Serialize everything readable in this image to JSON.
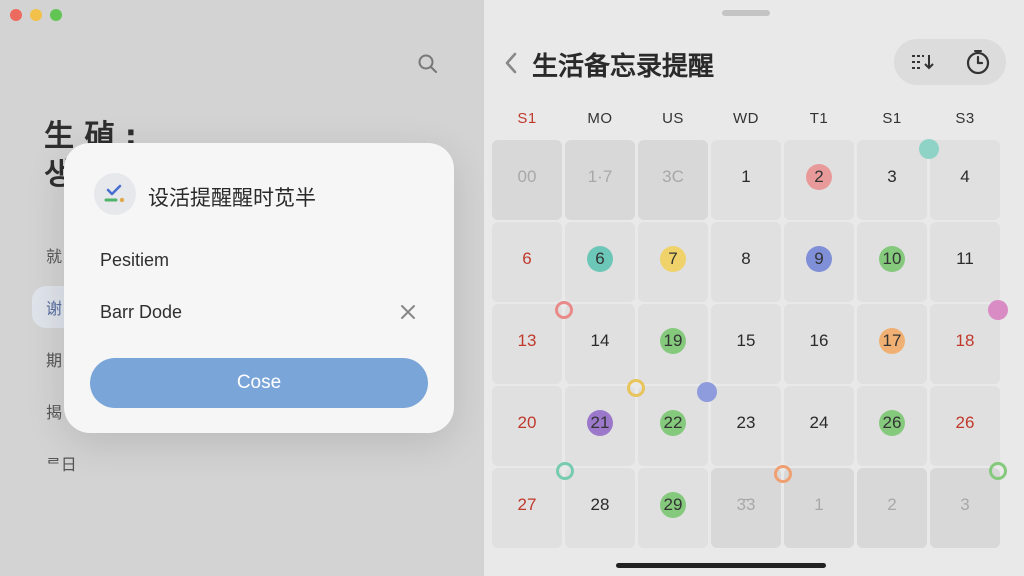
{
  "window": {
    "controls": [
      "close",
      "minimize",
      "zoom"
    ]
  },
  "left_pane": {
    "title_line1": "生 碵 :",
    "title_line2": "생",
    "items": [
      {
        "label": "就",
        "active": false
      },
      {
        "label": "谢",
        "active": true
      },
      {
        "label": "期",
        "active": false
      },
      {
        "label": "揭",
        "active": false
      },
      {
        "label": "ᄅ日",
        "active": false
      }
    ],
    "search_icon": "search-icon"
  },
  "modal": {
    "icon": "checklist-icon",
    "title": "设活提醒醒时苋半",
    "row1": "Pesitiem",
    "row2": "Barr Dode",
    "clear_icon": "close-icon",
    "button_label": "Cose"
  },
  "calendar": {
    "title": "生活备忘录提醒",
    "actions": [
      "export-icon",
      "clock-icon"
    ],
    "weekdays": [
      "S1",
      "MO",
      "US",
      "WD",
      "T1",
      "S1",
      "S3"
    ],
    "weeks": [
      [
        {
          "d": "00",
          "out": true
        },
        {
          "d": "1·7",
          "out": true
        },
        {
          "d": "3C",
          "out": true
        },
        {
          "d": "1"
        },
        {
          "d": "2",
          "c": "#e89a9a"
        },
        {
          "d": "3"
        },
        {
          "d": "4"
        }
      ],
      [
        {
          "d": "6",
          "sun": true
        },
        {
          "d": "6",
          "c": "#6cc7b8"
        },
        {
          "d": "7",
          "c": "#efd36a"
        },
        {
          "d": "8"
        },
        {
          "d": "9",
          "c": "#7f8fd8"
        },
        {
          "d": "10",
          "c": "#85c97d"
        },
        {
          "d": "11"
        }
      ],
      [
        {
          "d": "13",
          "sun": true
        },
        {
          "d": "14"
        },
        {
          "d": "19",
          "c": "#85c97d"
        },
        {
          "d": "15"
        },
        {
          "d": "16"
        },
        {
          "d": "17",
          "c": "#f1b073"
        },
        {
          "d": "18",
          "sun": true
        }
      ],
      [
        {
          "d": "20",
          "sun": true
        },
        {
          "d": "21",
          "c": "#9b78c9"
        },
        {
          "d": "22",
          "c": "#85c97d"
        },
        {
          "d": "23"
        },
        {
          "d": "24"
        },
        {
          "d": "26",
          "c": "#85c97d"
        },
        {
          "d": "26",
          "sun": true
        }
      ],
      [
        {
          "d": "27",
          "sun": true
        },
        {
          "d": "28"
        },
        {
          "d": "29",
          "c": "#85c97d"
        },
        {
          "d": "3̄3",
          "out": true
        },
        {
          "d": "1",
          "out": true
        },
        {
          "d": "2",
          "out": true
        },
        {
          "d": "3",
          "out": true
        }
      ]
    ],
    "colors": {
      "accent": "#7aa5d9",
      "sunday": "#c0392b"
    }
  }
}
